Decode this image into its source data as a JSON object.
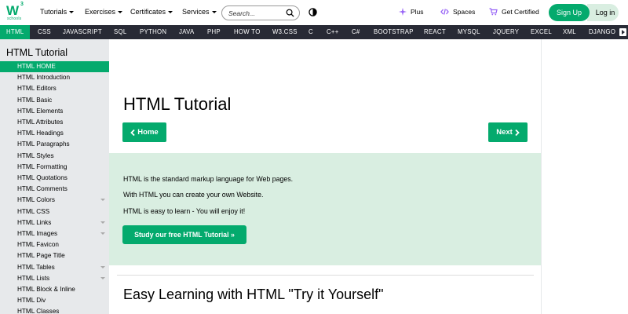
{
  "header": {
    "logo": {
      "letters": "W",
      "superscript": "3",
      "subtext": "schools"
    },
    "menu": [
      {
        "label": "Tutorials"
      },
      {
        "label": "Exercises"
      },
      {
        "label": "Certificates"
      },
      {
        "label": "Services"
      }
    ],
    "search": {
      "placeholder": "Search..."
    },
    "plus_label": "Plus",
    "spaces_label": "Spaces",
    "certified_label": "Get Certified",
    "signup_label": "Sign Up",
    "login_label": "Log in"
  },
  "topnav": {
    "items": [
      "HTML",
      "CSS",
      "JAVASCRIPT",
      "SQL",
      "PYTHON",
      "JAVA",
      "PHP",
      "HOW TO",
      "W3.CSS",
      "C",
      "C++",
      "C#",
      "BOOTSTRAP",
      "REACT",
      "MYSQL",
      "JQUERY",
      "EXCEL",
      "XML",
      "DJANGO"
    ],
    "active": "HTML"
  },
  "sidebar": {
    "title": "HTML Tutorial",
    "items": [
      {
        "label": "HTML HOME",
        "active": true
      },
      {
        "label": "HTML Introduction"
      },
      {
        "label": "HTML Editors"
      },
      {
        "label": "HTML Basic"
      },
      {
        "label": "HTML Elements"
      },
      {
        "label": "HTML Attributes"
      },
      {
        "label": "HTML Headings"
      },
      {
        "label": "HTML Paragraphs"
      },
      {
        "label": "HTML Styles"
      },
      {
        "label": "HTML Formatting"
      },
      {
        "label": "HTML Quotations"
      },
      {
        "label": "HTML Comments"
      },
      {
        "label": "HTML Colors",
        "expandable": true
      },
      {
        "label": "HTML CSS"
      },
      {
        "label": "HTML Links",
        "expandable": true
      },
      {
        "label": "HTML Images",
        "expandable": true
      },
      {
        "label": "HTML Favicon"
      },
      {
        "label": "HTML Page Title"
      },
      {
        "label": "HTML Tables",
        "expandable": true
      },
      {
        "label": "HTML Lists",
        "expandable": true
      },
      {
        "label": "HTML Block & Inline"
      },
      {
        "label": "HTML Div"
      },
      {
        "label": "HTML Classes"
      }
    ]
  },
  "main": {
    "title": "HTML Tutorial",
    "home_button": "Home",
    "next_button": "Next",
    "intro": [
      "HTML is the standard markup language for Web pages.",
      "With HTML you can create your own Website.",
      "HTML is easy to learn - You will enjoy it!"
    ],
    "study_button": "Study our free HTML Tutorial »",
    "section_title": "Easy Learning with HTML \"Try it Yourself\""
  },
  "colors": {
    "brand": "#04AA6D",
    "nav_dark": "#282A35",
    "sidebar_bg": "#E7E9EB",
    "intro_bg": "#D9EEE1"
  }
}
